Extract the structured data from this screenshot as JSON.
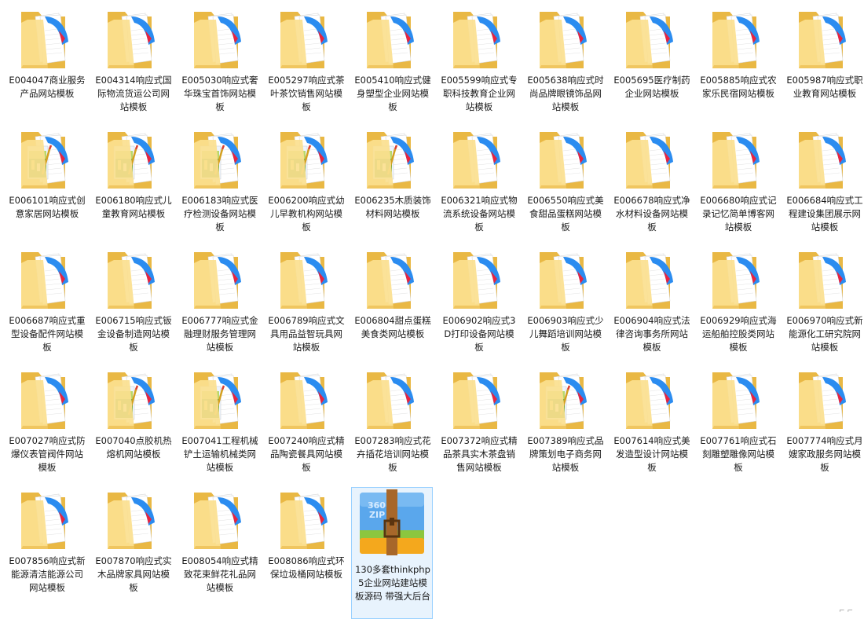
{
  "items": [
    {
      "name": "E004047商业服务产品网站模板",
      "icon": "folder-icon"
    },
    {
      "name": "E004314响应式国际物流货运公司网站模板",
      "icon": "folder-icon"
    },
    {
      "name": "E005030响应式奢华珠宝首饰网站模板",
      "icon": "folder-icon"
    },
    {
      "name": "E005297响应式茶叶茶饮销售网站模板",
      "icon": "folder-icon"
    },
    {
      "name": "E005410响应式健身塑型企业网站模板",
      "icon": "folder-icon"
    },
    {
      "name": "E005599响应式专职科技教育企业网站模板",
      "icon": "folder-icon"
    },
    {
      "name": "E005638响应式时尚品牌眼镜饰品网站模板",
      "icon": "folder-icon"
    },
    {
      "name": "E005695医疗制药企业网站模板",
      "icon": "folder-icon"
    },
    {
      "name": "E005885响应式农家乐民宿网站模板",
      "icon": "folder-icon"
    },
    {
      "name": "E005987响应式职业教育网站模板",
      "icon": "folder-icon"
    },
    {
      "name": "E006101响应式创意家居网站模板",
      "icon": "folder-image-icon"
    },
    {
      "name": "E006180响应式儿童教育网站模板",
      "icon": "folder-image-icon"
    },
    {
      "name": "E006183响应式医疗检测设备网站模板",
      "icon": "folder-image-icon"
    },
    {
      "name": "E006200响应式幼儿早教机构网站模板",
      "icon": "folder-image-icon"
    },
    {
      "name": "E006235木质装饰材料网站模板",
      "icon": "folder-image-icon"
    },
    {
      "name": "E006321响应式物流系统设备网站模板",
      "icon": "folder-icon"
    },
    {
      "name": "E006550响应式美食甜品蛋糕网站模板",
      "icon": "folder-icon"
    },
    {
      "name": "E006678响应式净水材料设备网站模板",
      "icon": "folder-icon"
    },
    {
      "name": "E006680响应式记录记忆简单博客网站模板",
      "icon": "folder-icon"
    },
    {
      "name": "E006684响应式工程建设集团展示网站模板",
      "icon": "folder-icon"
    },
    {
      "name": "E006687响应式重型设备配件网站模板",
      "icon": "folder-icon"
    },
    {
      "name": "E006715响应式钣金设备制造网站模板",
      "icon": "folder-icon"
    },
    {
      "name": "E006777响应式金融理财服务管理网站模板",
      "icon": "folder-icon"
    },
    {
      "name": "E006789响应式文具用品益智玩具网站模板",
      "icon": "folder-icon"
    },
    {
      "name": "E006804甜点蛋糕美食类网站模板",
      "icon": "folder-icon"
    },
    {
      "name": "E006902响应式3D打印设备网站模板",
      "icon": "folder-icon"
    },
    {
      "name": "E006903响应式少儿舞蹈培训网站模板",
      "icon": "folder-icon"
    },
    {
      "name": "E006904响应式法律咨询事务所网站模板",
      "icon": "folder-icon"
    },
    {
      "name": "E006929响应式海运船舶控股类网站模板",
      "icon": "folder-icon"
    },
    {
      "name": "E006970响应式新能源化工研究院网站模板",
      "icon": "folder-icon"
    },
    {
      "name": "E007027响应式防爆仪表管阀件网站模板",
      "icon": "folder-icon"
    },
    {
      "name": "E007040点胶机热熔机网站模板",
      "icon": "folder-image-icon"
    },
    {
      "name": "E007041工程机械铲土运输机械类网站模板",
      "icon": "folder-image-icon"
    },
    {
      "name": "E007240响应式精品陶瓷餐具网站模板",
      "icon": "folder-icon"
    },
    {
      "name": "E007283响应式花卉插花培训网站模板",
      "icon": "folder-icon"
    },
    {
      "name": "E007372响应式精品茶具实木茶盘销售网站模板",
      "icon": "folder-icon"
    },
    {
      "name": "E007389响应式品牌策划电子商务网站模板",
      "icon": "folder-image-icon"
    },
    {
      "name": "E007614响应式美发造型设计网站模板",
      "icon": "folder-icon"
    },
    {
      "name": "E007761响应式石刻雕塑雕像网站模板",
      "icon": "folder-icon"
    },
    {
      "name": "E007774响应式月嫂家政服务网站模板",
      "icon": "folder-icon"
    },
    {
      "name": "E007856响应式新能源清洁能源公司网站模板",
      "icon": "folder-icon"
    },
    {
      "name": "E007870响应式实木品牌家具网站模板",
      "icon": "folder-icon"
    },
    {
      "name": "E008054响应式精致花束鲜花礼品网站模板",
      "icon": "folder-icon"
    },
    {
      "name": "E008086响应式环保垃圾桶网站模板",
      "icon": "folder-icon"
    },
    {
      "name": "130多套thinkphp5企业网站建站模板源码 带强大后台",
      "icon": "zip-archive-icon",
      "selected": true,
      "zip_text_1": "360",
      "zip_text_2": "ZIP"
    }
  ],
  "colors": {
    "selection_bg": "#e8f3fd",
    "selection_border": "#99d1ff",
    "folder_back": "#e9b844",
    "folder_front": "#fbe08f",
    "doc_blue": "#2b8cf0",
    "doc_red": "#e8243f",
    "zip_blue": "#5aa7ec",
    "zip_green": "#8cc63f",
    "zip_orange": "#f4a81d",
    "zip_strap": "#a7672a"
  }
}
